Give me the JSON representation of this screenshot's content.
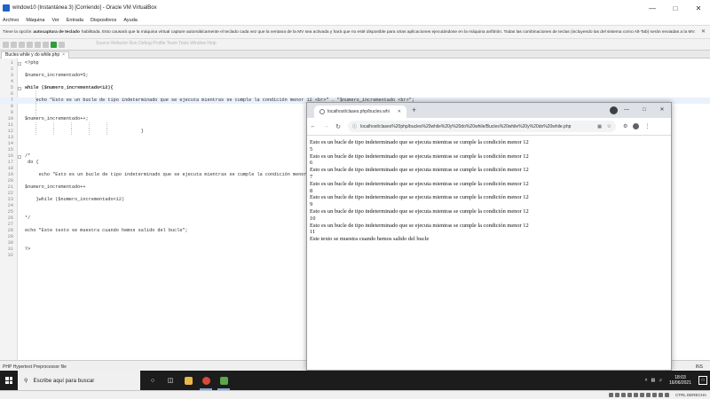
{
  "vbox": {
    "title": "window10 (Instantánea 3) [Corriendo] - Oracle VM VirtualBox",
    "menu": [
      "Archivo",
      "Máquina",
      "Ver",
      "Entrada",
      "Dispositivos",
      "Ayuda"
    ],
    "notice_pre": "Tiene la opción",
    "notice_bold": "autocaptura de teclado",
    "notice_text": "habilitada. Esto causará que la máquina virtual capture automáticamente el teclado cada vez que la ventana de la MV sea activada y hará que no esté disponible para otras aplicaciones ejecutándose en la máquina anfitrión. Todas las combinaciones de teclas (incluyendo las del sistema como Alt-Tab) serán enviadas a la MV.",
    "status_host_key": "CTRL DERECHA"
  },
  "editor": {
    "tab_label": "Bucles while y do while.php",
    "faded_menu": "Source  Refactor  Run  Debug  Profile  Team  Tools  Window  Help",
    "status_left": "PHP Hypertext Preprocessor file",
    "status_right": "INS",
    "lines": [
      {
        "n": "1",
        "code": "<?php"
      },
      {
        "n": "2",
        "code": ""
      },
      {
        "n": "3",
        "code": "$numero_incrementado=5;"
      },
      {
        "n": "4",
        "code": ""
      },
      {
        "n": "5",
        "code": "while ($numero_incrementado<12){"
      },
      {
        "n": "6",
        "code": ""
      },
      {
        "n": "7",
        "code": "    echo \"Esto es un bucle de tipo indeterminado que se ejecuta mientras se cumple la condición menor 12 <br>\" . \"$numero_incrementado <br>\";"
      },
      {
        "n": "8",
        "code": ""
      },
      {
        "n": "9",
        "code": ""
      },
      {
        "n": "10",
        "code": "$numero_incrementado++;"
      },
      {
        "n": "11",
        "code": ""
      },
      {
        "n": "12",
        "code": "                                          }"
      },
      {
        "n": "13",
        "code": ""
      },
      {
        "n": "14",
        "code": ""
      },
      {
        "n": "15",
        "code": ""
      },
      {
        "n": "16",
        "code": "/*"
      },
      {
        "n": "17",
        "code": " do {"
      },
      {
        "n": "18",
        "code": ""
      },
      {
        "n": "19",
        "code": "     echo \"Esto es un bucle de tipo indeterminado que se ejecuta mientras se cumple la condición menor 12 <br>\" . \"$numero_incrementado <br>\";"
      },
      {
        "n": "20",
        "code": ""
      },
      {
        "n": "21",
        "code": "$numero_incrementado++"
      },
      {
        "n": "22",
        "code": ""
      },
      {
        "n": "23",
        "code": "    }while ($numero_incrementado<12)"
      },
      {
        "n": "24",
        "code": ""
      },
      {
        "n": "25",
        "code": ""
      },
      {
        "n": "26",
        "code": "*/"
      },
      {
        "n": "27",
        "code": ""
      },
      {
        "n": "28",
        "code": "echo \"Este texto se muestra cuando hemos salido del bucle\";"
      },
      {
        "n": "29",
        "code": ""
      },
      {
        "n": "30",
        "code": ""
      },
      {
        "n": "31",
        "code": "?>"
      },
      {
        "n": "32",
        "code": ""
      }
    ]
  },
  "chrome": {
    "tab_title": "localhost/clases.php/bucles.whi",
    "url": "localhost/clases%20php/bucles%20while%20y%20do%20while/Bucles%20while%20y%20do%20while.php",
    "output": [
      "Esto es un bucle de tipo indeterminado que se ejecuta mientras se cumple la condición menor 12",
      "5",
      "Esto es un bucle de tipo indeterminado que se ejecuta mientras se cumple la condición menor 12",
      "6",
      "Esto es un bucle de tipo indeterminado que se ejecuta mientras se cumple la condición menor 12",
      "7",
      "Esto es un bucle de tipo indeterminado que se ejecuta mientras se cumple la condición menor 12",
      "8",
      "Esto es un bucle de tipo indeterminado que se ejecuta mientras se cumple la condición menor 12",
      "9",
      "Esto es un bucle de tipo indeterminado que se ejecuta mientras se cumple la condición menor 12",
      "10",
      "Esto es un bucle de tipo indeterminado que se ejecuta mientras se cumple la condición menor 12",
      "11",
      "Este texto se muestra cuando hemos salido del bucle"
    ]
  },
  "taskbar": {
    "search_placeholder": "Escribe aquí para buscar",
    "time": "18:03",
    "date": "16/06/2021"
  },
  "colors": {
    "taskbar": "#1c1c1c",
    "php_tag": "#c6402b",
    "keyword": "#1d2aa6",
    "string": "#a05e1f"
  }
}
